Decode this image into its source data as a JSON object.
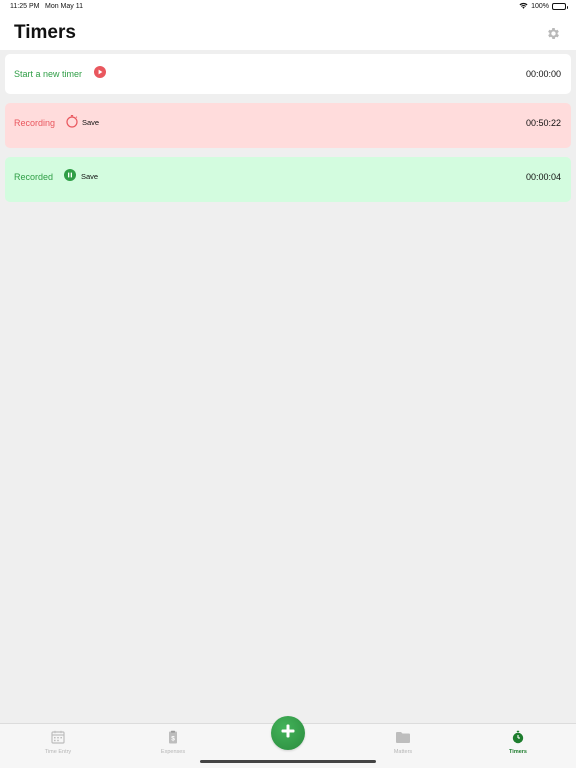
{
  "status_bar": {
    "time": "11:25 PM",
    "date": "Mon May 11",
    "battery": "100%"
  },
  "header": {
    "title": "Timers",
    "settings_icon": "gear-icon"
  },
  "timers": {
    "new": {
      "label": "Start a new timer",
      "time": "00:00:00",
      "icon": "play-icon"
    },
    "recording": {
      "label": "Recording",
      "save": "Save",
      "time": "00:50:22",
      "icon": "stopwatch-icon"
    },
    "recorded": {
      "label": "Recorded",
      "save": "Save",
      "time": "00:00:04",
      "icon": "pause-icon"
    }
  },
  "tab_bar": {
    "tabs": [
      {
        "label": "Time Entry",
        "icon": "calendar-icon",
        "active": false
      },
      {
        "label": "Expenses",
        "icon": "receipt-icon",
        "active": false
      },
      {
        "label": "Matters",
        "icon": "folder-icon",
        "active": false
      },
      {
        "label": "Timers",
        "icon": "stopwatch-icon",
        "active": true
      }
    ],
    "add_icon": "plus-icon"
  },
  "colors": {
    "accent_green": "#2f9e46",
    "recording_red": "#e9575e",
    "recording_bg": "#ffdcdc",
    "recorded_bg": "#d3fcdf",
    "active_tab": "#1e7d2e",
    "inactive_tab": "#b6b6b6"
  }
}
